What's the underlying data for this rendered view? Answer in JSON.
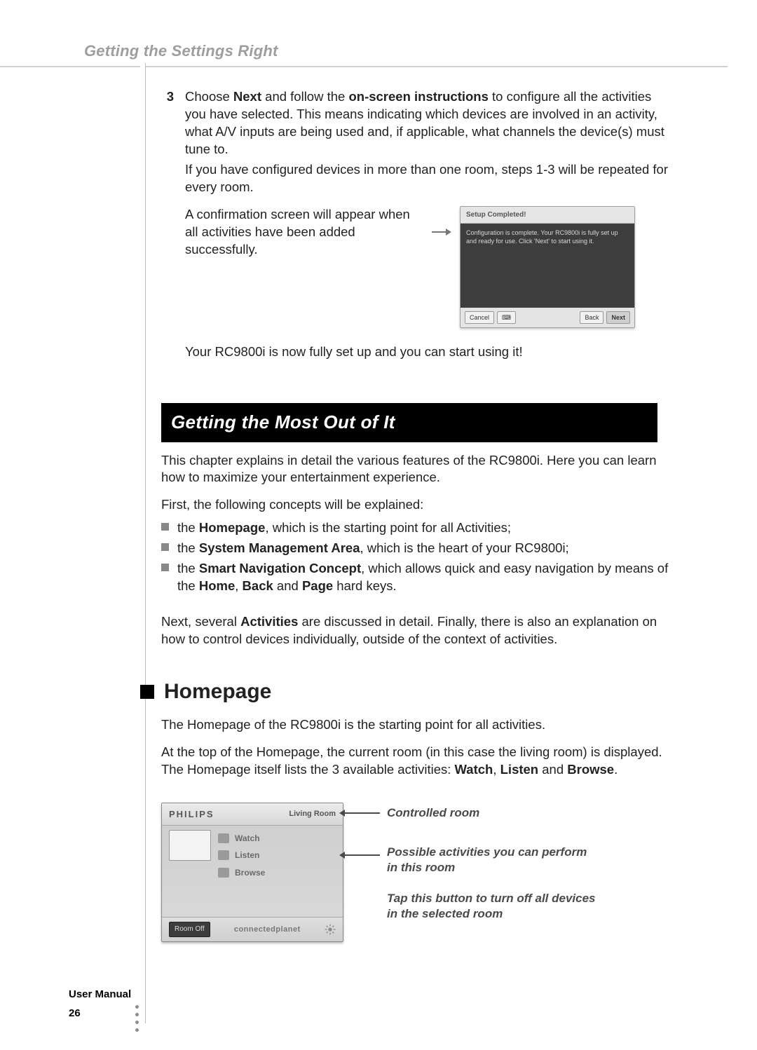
{
  "running_head": "Getting the Settings Right",
  "step": {
    "num": "3",
    "line1_a": "Choose ",
    "line1_b": "Next",
    "line1_c": " and follow the ",
    "line1_d": "on-screen instructions",
    "line1_e": " to configure all the activities you have selected. This means indicating which devices are involved in an activity, what A/V inputs are being used and, if applicable, what channels the device(s) must tune to.",
    "line2": "If you have configured devices in more than one room, steps 1-3 will be repeated for every room.",
    "confirm": "A confirmation screen will appear when all activities have been added successfully."
  },
  "setup_shot": {
    "title": "Setup Completed!",
    "body": "Configuration is complete. Your RC9800i is fully set up and ready for use. Click 'Next' to start using it.",
    "btn_cancel": "Cancel",
    "btn_back": "Back",
    "btn_next": "Next"
  },
  "after_shot": "Your RC9800i is now fully set up and you can start using it!",
  "chapter": "Getting the Most Out of It",
  "chapter_intro": "This chapter explains in detail the various features of the RC9800i. Here you can learn how to maximize your entertainment experience.",
  "first_line": "First, the following concepts will be explained:",
  "bullets": {
    "b1_a": "the ",
    "b1_b": "Homepage",
    "b1_c": ", which is the starting point for all Activities;",
    "b2_a": "the ",
    "b2_b": "System Management Area",
    "b2_c": ", which is the heart of your RC9800i;",
    "b3_a": "the ",
    "b3_b": "Smart Navigation Concept",
    "b3_c": ", which allows quick and easy navigation by means of the ",
    "b3_d": "Home",
    "b3_e": ", ",
    "b3_f": "Back",
    "b3_g": " and ",
    "b3_h": "Page",
    "b3_i": " hard keys."
  },
  "next_para_a": "Next, several ",
  "next_para_b": "Activities",
  "next_para_c": " are discussed in detail. Finally, there is also an explanation on how to control devices individually, outside of the context of activities.",
  "section_homepage": "Homepage",
  "hp_p1": "The Homepage of the RC9800i is the starting point for all activities.",
  "hp_p2_a": "At the top of the Homepage, the current room (in this case the living room) is displayed. The Homepage itself lists the 3 available activities: ",
  "hp_p2_b": "Watch",
  "hp_p2_c": ", ",
  "hp_p2_d": "Listen",
  "hp_p2_e": " and ",
  "hp_p2_f": "Browse",
  "hp_p2_g": ".",
  "home_shot": {
    "brand": "PHILIPS",
    "room": "Living Room",
    "acts": [
      "Watch",
      "Listen",
      "Browse"
    ],
    "room_off": "Room Off",
    "cp": "connectedplanet"
  },
  "callouts": {
    "c1": "Controlled room",
    "c2": "Possible activities you can perform in this room",
    "c3": "Tap this button to turn off all devices in the selected room"
  },
  "footer": {
    "title": "User Manual",
    "page": "26"
  }
}
